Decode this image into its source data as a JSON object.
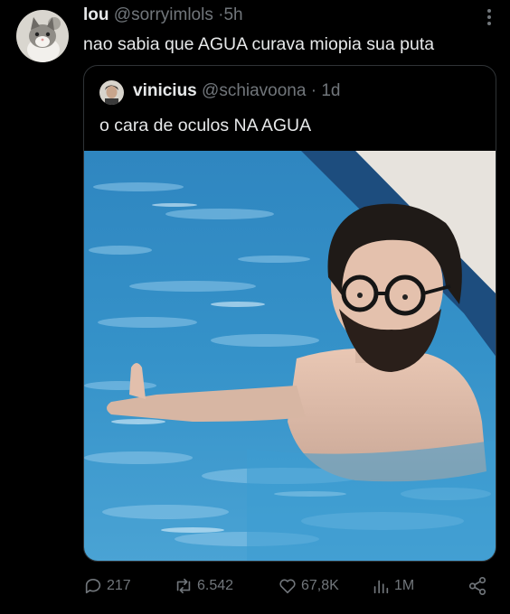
{
  "tweet": {
    "author_name": "lou",
    "author_handle": "@sorryimlols",
    "time": "5h",
    "text": "nao sabia que AGUA curava miopia sua puta"
  },
  "quote": {
    "author_name": "vinicius",
    "author_handle": "@schiavoona",
    "time": "1d",
    "text": "o cara de oculos NA AGUA"
  },
  "actions": {
    "replies": "217",
    "retweets": "6.542",
    "likes": "67,8K",
    "views": "1M"
  },
  "icons": [
    "reply-icon",
    "retweet-icon",
    "like-icon",
    "views-icon",
    "share-icon",
    "more-icon"
  ],
  "colors": {
    "background": "#000000",
    "text": "#e7e9ea",
    "muted": "#71767b",
    "border": "#2f3336"
  }
}
